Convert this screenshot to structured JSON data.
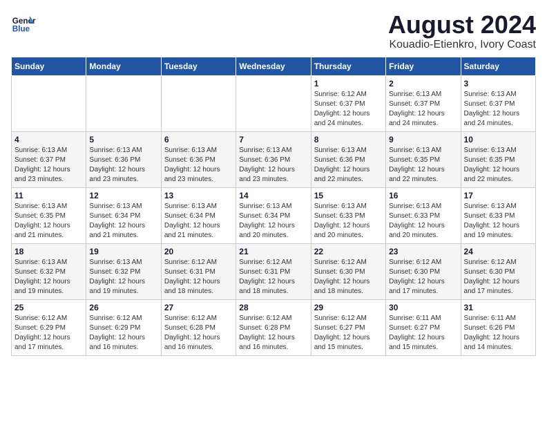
{
  "header": {
    "logo_line1": "General",
    "logo_line2": "Blue",
    "main_title": "August 2024",
    "subtitle": "Kouadio-Etienkro, Ivory Coast"
  },
  "days_of_week": [
    "Sunday",
    "Monday",
    "Tuesday",
    "Wednesday",
    "Thursday",
    "Friday",
    "Saturday"
  ],
  "weeks": [
    [
      {
        "day": "",
        "info": ""
      },
      {
        "day": "",
        "info": ""
      },
      {
        "day": "",
        "info": ""
      },
      {
        "day": "",
        "info": ""
      },
      {
        "day": "1",
        "info": "Sunrise: 6:12 AM\nSunset: 6:37 PM\nDaylight: 12 hours\nand 24 minutes."
      },
      {
        "day": "2",
        "info": "Sunrise: 6:13 AM\nSunset: 6:37 PM\nDaylight: 12 hours\nand 24 minutes."
      },
      {
        "day": "3",
        "info": "Sunrise: 6:13 AM\nSunset: 6:37 PM\nDaylight: 12 hours\nand 24 minutes."
      }
    ],
    [
      {
        "day": "4",
        "info": "Sunrise: 6:13 AM\nSunset: 6:37 PM\nDaylight: 12 hours\nand 23 minutes."
      },
      {
        "day": "5",
        "info": "Sunrise: 6:13 AM\nSunset: 6:36 PM\nDaylight: 12 hours\nand 23 minutes."
      },
      {
        "day": "6",
        "info": "Sunrise: 6:13 AM\nSunset: 6:36 PM\nDaylight: 12 hours\nand 23 minutes."
      },
      {
        "day": "7",
        "info": "Sunrise: 6:13 AM\nSunset: 6:36 PM\nDaylight: 12 hours\nand 23 minutes."
      },
      {
        "day": "8",
        "info": "Sunrise: 6:13 AM\nSunset: 6:36 PM\nDaylight: 12 hours\nand 22 minutes."
      },
      {
        "day": "9",
        "info": "Sunrise: 6:13 AM\nSunset: 6:35 PM\nDaylight: 12 hours\nand 22 minutes."
      },
      {
        "day": "10",
        "info": "Sunrise: 6:13 AM\nSunset: 6:35 PM\nDaylight: 12 hours\nand 22 minutes."
      }
    ],
    [
      {
        "day": "11",
        "info": "Sunrise: 6:13 AM\nSunset: 6:35 PM\nDaylight: 12 hours\nand 21 minutes."
      },
      {
        "day": "12",
        "info": "Sunrise: 6:13 AM\nSunset: 6:34 PM\nDaylight: 12 hours\nand 21 minutes."
      },
      {
        "day": "13",
        "info": "Sunrise: 6:13 AM\nSunset: 6:34 PM\nDaylight: 12 hours\nand 21 minutes."
      },
      {
        "day": "14",
        "info": "Sunrise: 6:13 AM\nSunset: 6:34 PM\nDaylight: 12 hours\nand 20 minutes."
      },
      {
        "day": "15",
        "info": "Sunrise: 6:13 AM\nSunset: 6:33 PM\nDaylight: 12 hours\nand 20 minutes."
      },
      {
        "day": "16",
        "info": "Sunrise: 6:13 AM\nSunset: 6:33 PM\nDaylight: 12 hours\nand 20 minutes."
      },
      {
        "day": "17",
        "info": "Sunrise: 6:13 AM\nSunset: 6:33 PM\nDaylight: 12 hours\nand 19 minutes."
      }
    ],
    [
      {
        "day": "18",
        "info": "Sunrise: 6:13 AM\nSunset: 6:32 PM\nDaylight: 12 hours\nand 19 minutes."
      },
      {
        "day": "19",
        "info": "Sunrise: 6:13 AM\nSunset: 6:32 PM\nDaylight: 12 hours\nand 19 minutes."
      },
      {
        "day": "20",
        "info": "Sunrise: 6:12 AM\nSunset: 6:31 PM\nDaylight: 12 hours\nand 18 minutes."
      },
      {
        "day": "21",
        "info": "Sunrise: 6:12 AM\nSunset: 6:31 PM\nDaylight: 12 hours\nand 18 minutes."
      },
      {
        "day": "22",
        "info": "Sunrise: 6:12 AM\nSunset: 6:30 PM\nDaylight: 12 hours\nand 18 minutes."
      },
      {
        "day": "23",
        "info": "Sunrise: 6:12 AM\nSunset: 6:30 PM\nDaylight: 12 hours\nand 17 minutes."
      },
      {
        "day": "24",
        "info": "Sunrise: 6:12 AM\nSunset: 6:30 PM\nDaylight: 12 hours\nand 17 minutes."
      }
    ],
    [
      {
        "day": "25",
        "info": "Sunrise: 6:12 AM\nSunset: 6:29 PM\nDaylight: 12 hours\nand 17 minutes."
      },
      {
        "day": "26",
        "info": "Sunrise: 6:12 AM\nSunset: 6:29 PM\nDaylight: 12 hours\nand 16 minutes."
      },
      {
        "day": "27",
        "info": "Sunrise: 6:12 AM\nSunset: 6:28 PM\nDaylight: 12 hours\nand 16 minutes."
      },
      {
        "day": "28",
        "info": "Sunrise: 6:12 AM\nSunset: 6:28 PM\nDaylight: 12 hours\nand 16 minutes."
      },
      {
        "day": "29",
        "info": "Sunrise: 6:12 AM\nSunset: 6:27 PM\nDaylight: 12 hours\nand 15 minutes."
      },
      {
        "day": "30",
        "info": "Sunrise: 6:11 AM\nSunset: 6:27 PM\nDaylight: 12 hours\nand 15 minutes."
      },
      {
        "day": "31",
        "info": "Sunrise: 6:11 AM\nSunset: 6:26 PM\nDaylight: 12 hours\nand 14 minutes."
      }
    ]
  ]
}
